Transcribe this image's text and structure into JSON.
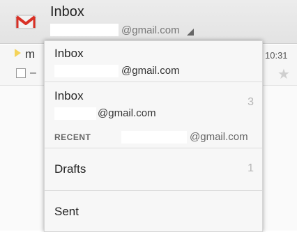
{
  "header": {
    "title": "Inbox",
    "email": "@gmail.com",
    "logo_icon": "gmail-logo-icon",
    "logo_color": "#d93025"
  },
  "conversation": {
    "sender_initial": "m",
    "snippet": "–",
    "time": "10:31",
    "star_icon": "star-icon"
  },
  "dropdown": {
    "accounts": [
      {
        "label": "Inbox",
        "email": "@gmail.com"
      },
      {
        "label": "Inbox",
        "email": "@gmail.com",
        "count": "3"
      }
    ],
    "recent": {
      "label": "RECENT",
      "email": "@gmail.com"
    },
    "folders": [
      {
        "label": "Drafts",
        "count": "1"
      },
      {
        "label": "Sent"
      }
    ]
  }
}
